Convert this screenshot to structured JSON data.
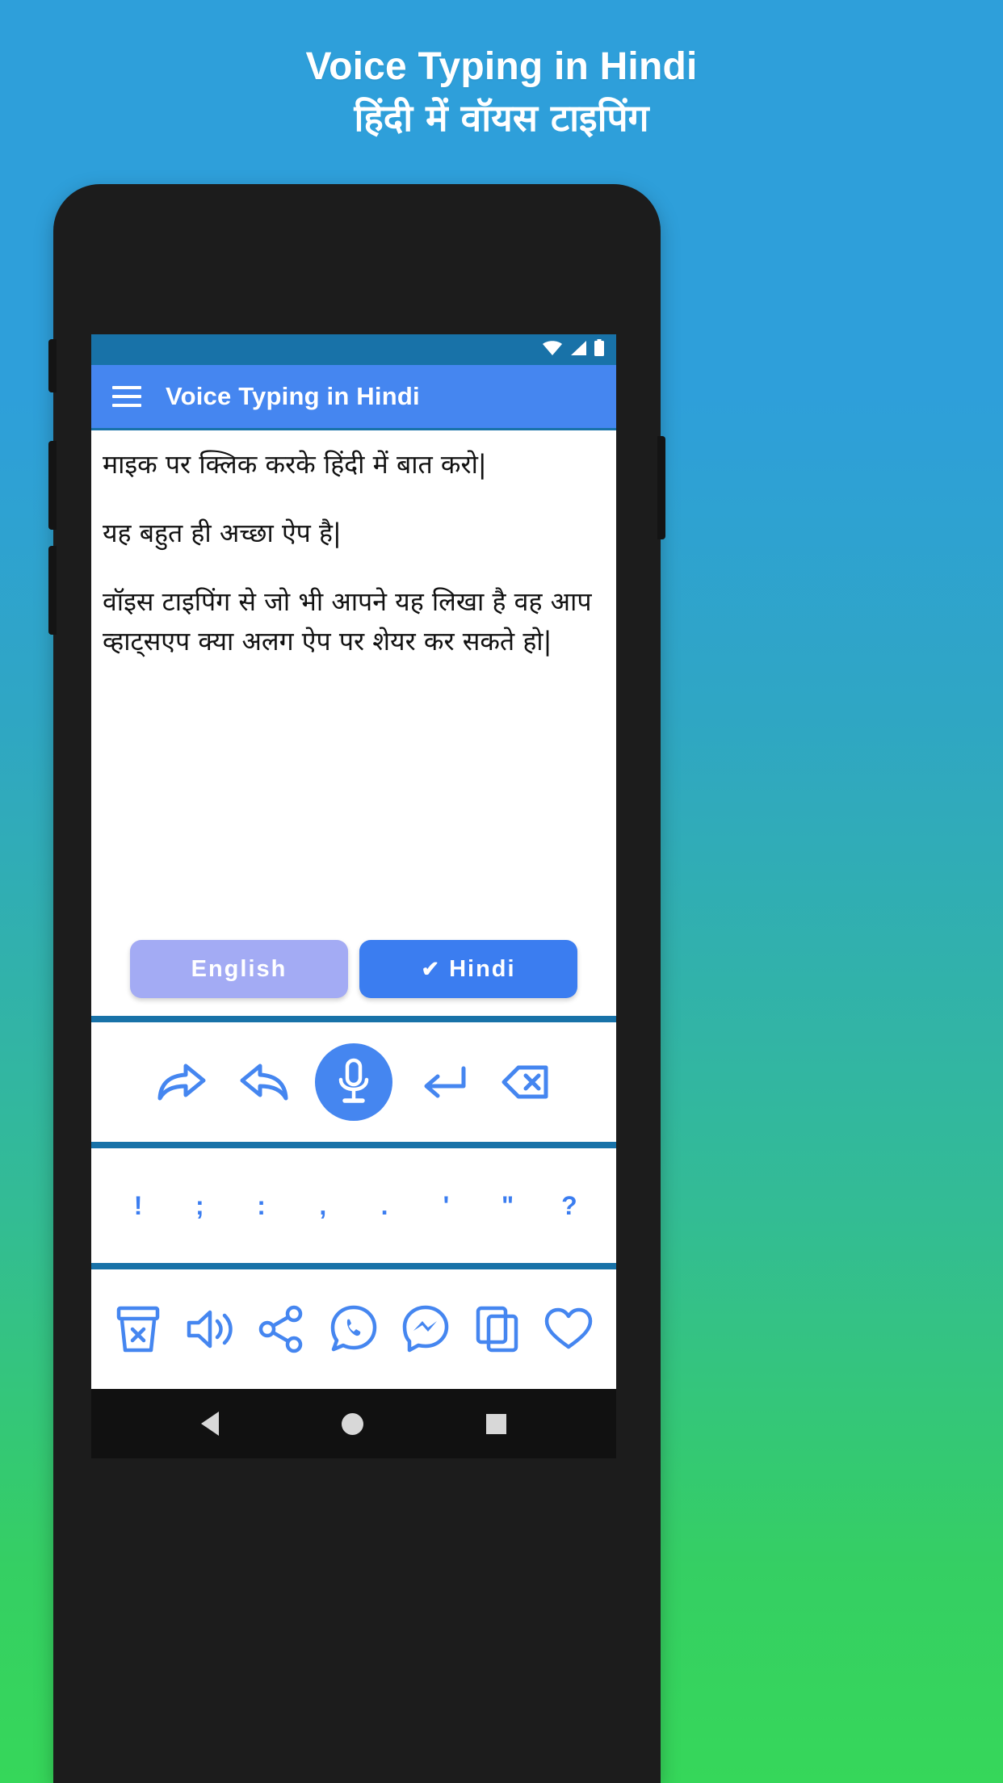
{
  "promo": {
    "title": "Voice Typing in Hindi",
    "subtitle": "हिंदी में वॉयस टाइपिंग",
    "bg_top_color": "#2e9fda",
    "bg_bottom_color": "#36d75a"
  },
  "statusbar": {
    "wifi_icon": "wifi-icon",
    "signal_icon": "signal-icon",
    "battery_icon": "battery-icon"
  },
  "appbar": {
    "menu_icon": "hamburger-menu-icon",
    "title": "Voice Typing in Hindi",
    "color": "#4586f0"
  },
  "editor": {
    "paragraphs": [
      "माइक पर क्लिक करके हिंदी में बात करो|",
      "यह बहुत ही अच्छा ऐप है|",
      "वॉइस टाइपिंग से जो भी आपने यह लिखा है वह आप व्हाट्सएप क्या अलग ऐप पर शेयर कर सकते हो|"
    ]
  },
  "language_toggle": {
    "english": {
      "label": "English",
      "selected": false,
      "color": "#a3abf4"
    },
    "hindi": {
      "label": "Hindi",
      "selected": true,
      "color": "#3b7df0",
      "check_glyph": "✔"
    }
  },
  "controls": [
    {
      "name": "redo-icon",
      "label": "Redo"
    },
    {
      "name": "undo-icon",
      "label": "Undo"
    },
    {
      "name": "microphone-icon",
      "label": "Microphone"
    },
    {
      "name": "enter-newline-icon",
      "label": "New line"
    },
    {
      "name": "backspace-icon",
      "label": "Backspace"
    }
  ],
  "punctuation": [
    "!",
    ";",
    ":",
    ",",
    ".",
    "'",
    "\"",
    "?"
  ],
  "share_actions": [
    {
      "name": "clear-trash-icon",
      "label": "Clear"
    },
    {
      "name": "speaker-icon",
      "label": "Speak"
    },
    {
      "name": "share-icon",
      "label": "Share"
    },
    {
      "name": "whatsapp-icon",
      "label": "WhatsApp"
    },
    {
      "name": "messenger-icon",
      "label": "Messenger"
    },
    {
      "name": "copy-icon",
      "label": "Copy"
    },
    {
      "name": "favorite-heart-icon",
      "label": "Favorite"
    }
  ],
  "navbar": {
    "back": "nav-back-icon",
    "home": "nav-home-icon",
    "recents": "nav-recents-icon"
  },
  "colors": {
    "accent": "#4586f0",
    "status_bar": "#1872a8",
    "divider": "#1872a8"
  }
}
